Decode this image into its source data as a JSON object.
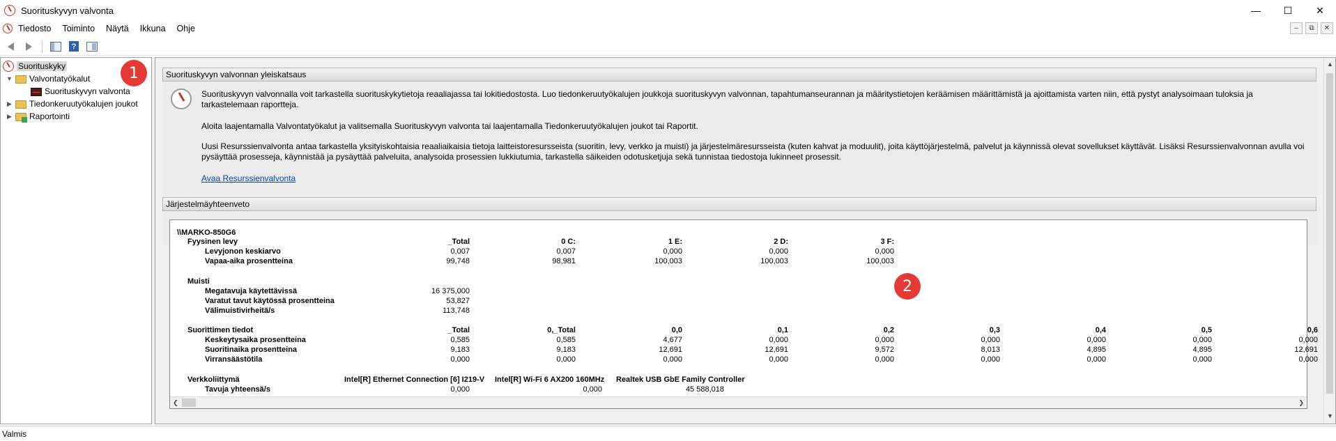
{
  "window": {
    "title": "Suorituskyvyn valvonta"
  },
  "menu": [
    "Tiedosto",
    "Toiminto",
    "Näytä",
    "Ikkuna",
    "Ohje"
  ],
  "tree": {
    "root": "Suorituskyky",
    "tools": "Valvontatyökalut",
    "monitor": "Suorituskyvyn valvonta",
    "collectors": "Tiedonkeruutyökalujen joukot",
    "reports": "Raportointi"
  },
  "overview": {
    "header": "Suorituskyvyn valvonnan yleiskatsaus",
    "p1": "Suorituskyvyn valvonnalla voit tarkastella suorituskykytietoja reaaliajassa tai lokitiedostosta. Luo tiedonkeruutyökalujen joukkoja suorituskyvyn valvonnan, tapahtumanseurannan ja määritystietojen keräämisen määrittämistä ja ajoittamista varten niin, että pystyt analysoimaan tuloksia ja tarkastelemaan raportteja.",
    "p2": "Aloita laajentamalla Valvontatyökalut ja valitsemalla Suorituskyvyn valvonta tai laajentamalla Tiedonkeruutyökalujen joukot tai Raportit.",
    "p3": "Uusi Resurssienvalvonta antaa tarkastella yksityiskohtaisia reaaliaikaisia tietoja laitteistoresursseista (suoritin, levy, verkko ja muisti) ja järjestelmäresursseista (kuten kahvat ja moduulit), joita käyttöjärjestelmä, palvelut ja käynnissä olevat sovellukset käyttävät. Lisäksi Resurssienvalvonnan avulla voi pysäyttää prosesseja, käynnistää ja pysäyttää palveluita, analysoida prosessien lukkiutumia, tarkastella säikeiden odotusketjuja sekä tunnistaa tiedostoja lukinneet prosessit.",
    "link": "Avaa Resurssienvalvonta"
  },
  "summary": {
    "header": "Järjestelmäyhteenveto",
    "machine": "\\\\MARKO-850G6",
    "disk": {
      "title": "Fyysinen levy",
      "cols": [
        "_Total",
        "0 C:",
        "1 E:",
        "2 D:",
        "3 F:"
      ],
      "rows": [
        {
          "label": "Levyjonon keskiarvo",
          "values": [
            "0,007",
            "0,007",
            "0,000",
            "0,000",
            "0,000"
          ]
        },
        {
          "label": "Vapaa-aika prosentteina",
          "values": [
            "99,748",
            "98,981",
            "100,003",
            "100,003",
            "100,003"
          ]
        }
      ]
    },
    "memory": {
      "title": "Muisti",
      "rows": [
        {
          "label": "Megatavuja käytettävissä",
          "value": "16 375,000"
        },
        {
          "label": "Varatut tavut käytössä prosentteina",
          "value": "53,827"
        },
        {
          "label": "Välimuistivirheitä/s",
          "value": "113,748"
        }
      ]
    },
    "cpu": {
      "title": "Suorittimen tiedot",
      "cols": [
        "_Total",
        "0,_Total",
        "0,0",
        "0,1",
        "0,2",
        "0,3",
        "0,4",
        "0,5",
        "0,6"
      ],
      "rows": [
        {
          "label": "Keskeytysaika prosentteina",
          "values": [
            "0,585",
            "0,585",
            "4,677",
            "0,000",
            "0,000",
            "0,000",
            "0,000",
            "0,000",
            "0,000"
          ]
        },
        {
          "label": "Suoritinaika prosentteina",
          "values": [
            "9,183",
            "9,183",
            "12,691",
            "12,691",
            "9,572",
            "8,013",
            "4,895",
            "4,895",
            "12,691"
          ]
        },
        {
          "label": "Virransäästötila",
          "values": [
            "0,000",
            "0,000",
            "0,000",
            "0,000",
            "0,000",
            "0,000",
            "0,000",
            "0,000",
            "0,000"
          ]
        }
      ]
    },
    "network": {
      "title": "Verkkoliittymä",
      "cols": [
        "Intel[R] Ethernet Connection [6] I219-V",
        "Intel[R] Wi-Fi 6 AX200 160MHz",
        "Realtek USB GbE Family Controller"
      ],
      "row": {
        "label": "Tavuja yhteensä/s",
        "values": [
          "0,000",
          "0,000",
          "45 588,018"
        ]
      }
    }
  },
  "badges": [
    "1",
    "2"
  ],
  "status": "Valmis"
}
